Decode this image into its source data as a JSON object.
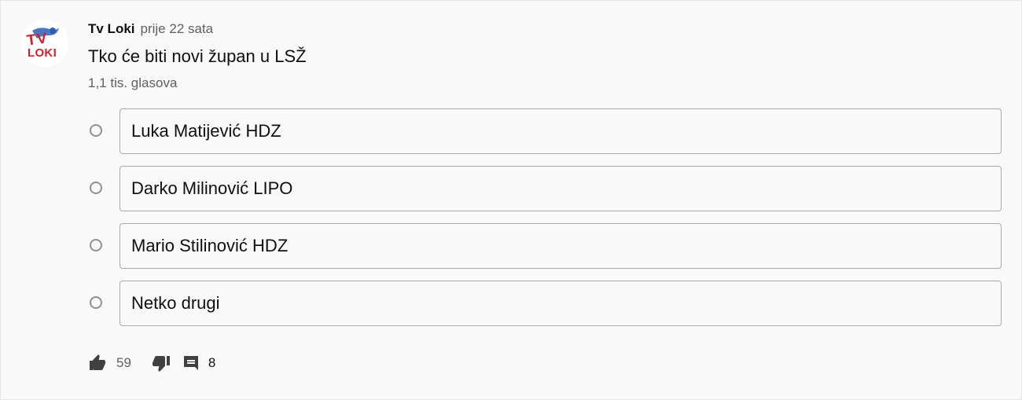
{
  "post": {
    "channel_name": "Tv Loki",
    "time_ago": "prije 22 sata",
    "avatar_logo_text": [
      "TV",
      "LOKI"
    ]
  },
  "poll": {
    "question": "Tko će biti novi župan u LSŽ",
    "vote_count": "1,1 tis. glasova",
    "options": [
      "Luka Matijević HDZ",
      "Darko Milinović LIPO",
      "Mario Stilinović HDZ",
      "Netko drugi"
    ]
  },
  "actions": {
    "like_icon": "thumb-up-icon",
    "like_count": "59",
    "dislike_icon": "thumb-down-icon",
    "comment_icon": "comment-icon",
    "comment_count": "8"
  },
  "colors": {
    "background": "#f9f9f9",
    "text_primary": "#0f0f0f",
    "text_secondary": "#606060",
    "option_border": "#aaaaaa",
    "logo_red": "#d0202a",
    "logo_blue": "#2b5fb4"
  }
}
